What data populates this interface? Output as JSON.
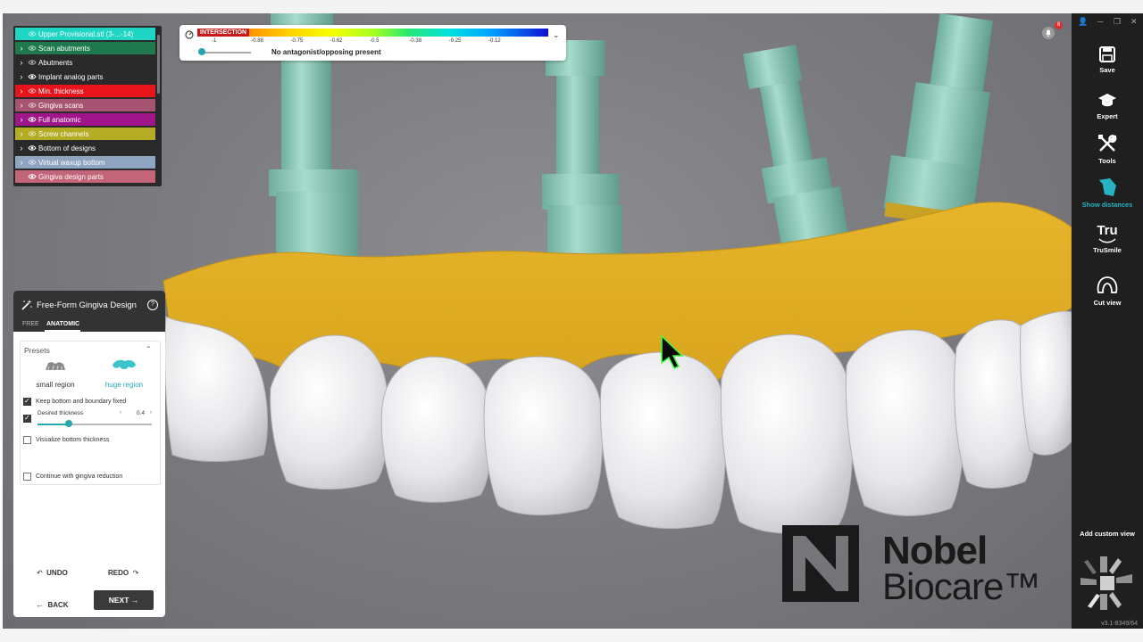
{
  "layers": [
    {
      "label": "Upper Provisional.stl (3-...-14)",
      "color": "#1fd6c4",
      "chevron": false,
      "eye_dim": true
    },
    {
      "label": "Scan abutments",
      "color": "#1e7a4e",
      "chevron": true,
      "eye_dim": true
    },
    {
      "label": "Abutments",
      "color": "#2a2a2a",
      "chevron": true,
      "eye_dim": true
    },
    {
      "label": "Implant analog parts",
      "color": "#2a2a2a",
      "chevron": true,
      "eye_dim": false
    },
    {
      "label": "Min. thickness",
      "color": "#e8141c",
      "chevron": true,
      "eye_dim": true
    },
    {
      "label": "Gingiva scans",
      "color": "#a65472",
      "chevron": true,
      "eye_dim": true
    },
    {
      "label": "Full anatomic",
      "color": "#a0168a",
      "chevron": true,
      "eye_dim": false
    },
    {
      "label": "Screw channels",
      "color": "#b4ac24",
      "chevron": true,
      "eye_dim": true
    },
    {
      "label": "Bottom of designs",
      "color": "#2a2a2a",
      "chevron": true,
      "eye_dim": false
    },
    {
      "label": "Virtual waxup bottom",
      "color": "#8ea4c0",
      "chevron": true,
      "eye_dim": true
    },
    {
      "label": "Gingiva design parts",
      "color": "#c46478",
      "chevron": false,
      "eye_dim": false
    }
  ],
  "legend": {
    "title": "INTERSECTION",
    "ticks": [
      "-1",
      "-0.88",
      "-0.75",
      "-0.62",
      "-0.5",
      "-0.38",
      "-0.25",
      "-0.12"
    ],
    "message": "No antagonist/opposing present"
  },
  "toolbar": {
    "save": "Save",
    "expert": "Expert",
    "tools": "Tools",
    "show_distances": "Show distances",
    "trusmile": "TruSmile",
    "trusmile_icon": "Tru",
    "cut_view": "Cut view",
    "add_custom_view": "Add custom view",
    "version": "v3.1-8349/64",
    "notifications": "8"
  },
  "panel": {
    "title": "Free-Form Gingiva Design",
    "help": "?",
    "tabs": [
      "FREE",
      "ANATOMIC"
    ],
    "presets_title": "Presets",
    "preset_small": "small region",
    "preset_huge": "huge region",
    "keep_fixed": "Keep bottom and boundary fixed",
    "keep_fixed_checked": true,
    "desired_thickness": "Desired thickness",
    "desired_thickness_checked": true,
    "thickness_value": "0.4",
    "thickness_level": 0.27,
    "visualize_bottom": "Visualize bottom thickness",
    "visualize_bottom_checked": false,
    "continue_reduction": "Continue with gingiva reduction",
    "continue_reduction_checked": false,
    "undo": "UNDO",
    "redo": "REDO",
    "back": "BACK",
    "next": "NEXT"
  },
  "logo": {
    "line1": "Nobel",
    "line2": "Biocare™"
  }
}
